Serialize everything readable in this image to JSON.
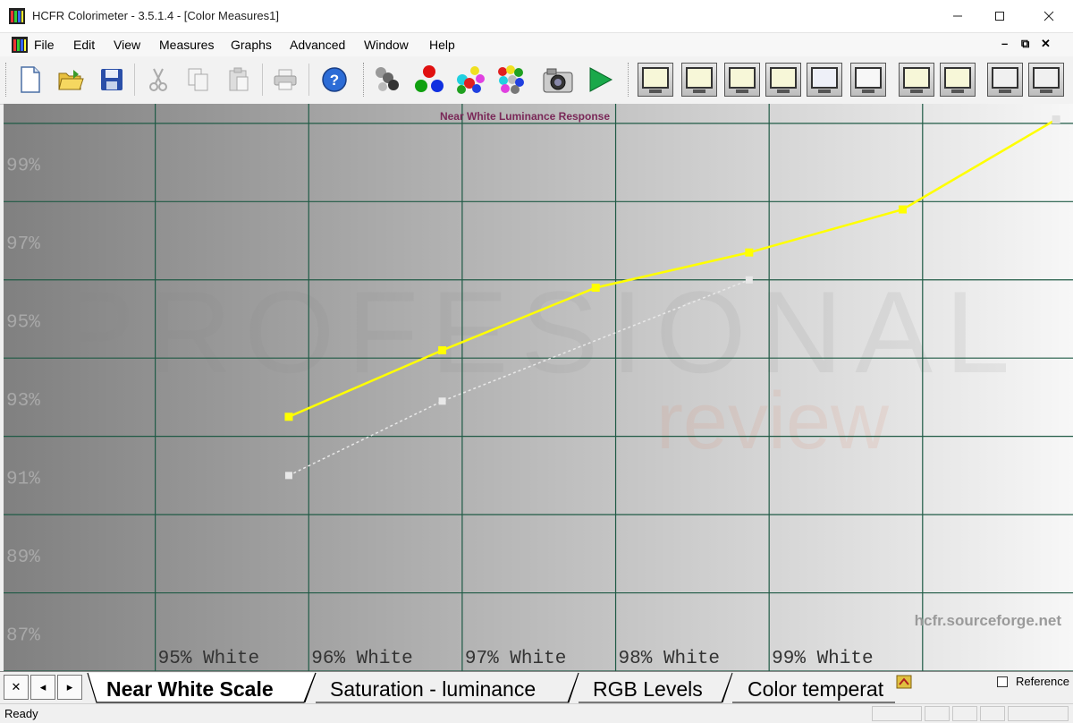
{
  "window": {
    "title": "HCFR Colorimeter - 3.5.1.4 - [Color Measures1]"
  },
  "menu": {
    "items": [
      "File",
      "Edit",
      "View",
      "Measures",
      "Graphs",
      "Advanced",
      "Window",
      "Help"
    ]
  },
  "toolbar": {
    "file_buttons": [
      "new-document",
      "open-folder",
      "save"
    ],
    "edit_buttons": [
      "cut",
      "copy",
      "paste"
    ],
    "misc_buttons": [
      "print",
      "help"
    ],
    "measure_buttons": [
      "measure-gray",
      "measure-primaries",
      "measure-secondaries",
      "measure-all-colors",
      "camera",
      "start-measure"
    ],
    "graph_buttons": [
      "graph-view-1",
      "graph-view-2",
      "graph-view-3",
      "graph-view-4",
      "graph-view-5",
      "graph-view-6",
      "graph-view-7",
      "graph-view-8",
      "graph-view-9",
      "graph-view-10"
    ]
  },
  "chart_data": {
    "type": "line",
    "title": "Near White Luminance Response",
    "watermark": "hcfr.sourceforge.net",
    "x": [
      95,
      96,
      97,
      98,
      99,
      100
    ],
    "categories": [
      "95% White",
      "96% White",
      "97% White",
      "98% White",
      "99% White"
    ],
    "ylim": [
      86,
      100.5
    ],
    "yticks": [
      87,
      89,
      91,
      93,
      95,
      97,
      99
    ],
    "ytick_labels": [
      "87%",
      "89%",
      "91%",
      "93%",
      "95%",
      "97%",
      "99%"
    ],
    "grid": true,
    "series": [
      {
        "values": [
          92.5,
          94.2,
          95.8,
          96.7,
          97.8,
          100.1
        ],
        "color": "#ffff00",
        "style": "solid"
      },
      {
        "values": [
          91.0,
          92.9,
          null,
          96.0,
          null,
          null
        ],
        "color": "#e8e8e8",
        "style": "dashed"
      }
    ],
    "colors": {
      "grid": "#1f5a45",
      "title": "#7a2858",
      "series_main": "#ffff00",
      "series_ref": "#e8e8e8"
    }
  },
  "tabs": [
    {
      "label": "Near White Scale",
      "active": true
    },
    {
      "label": "Saturation - luminance",
      "active": false
    },
    {
      "label": "RGB Levels",
      "active": false
    },
    {
      "label": "Color temperat",
      "active": false
    }
  ],
  "reference": {
    "label": "Reference",
    "checked": false
  },
  "status": {
    "text": "Ready"
  }
}
